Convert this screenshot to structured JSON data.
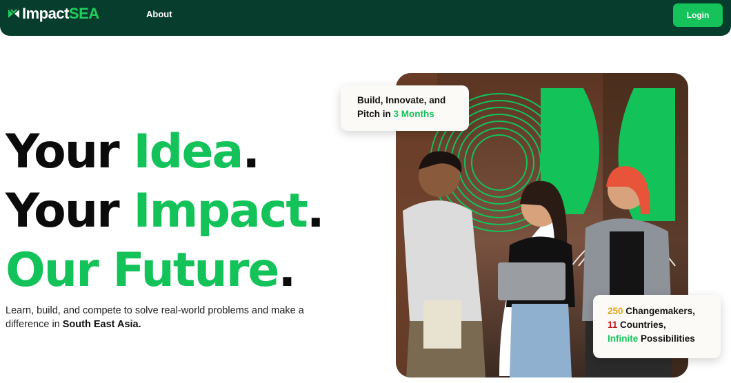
{
  "nav": {
    "logo_prefix": "Impact",
    "logo_suffix": "SEA",
    "about_label": "About",
    "login_label": "Login"
  },
  "hero": {
    "line1_a": "Your ",
    "line1_b": "Idea",
    "line2_a": "Your ",
    "line2_b": "Impact",
    "line3": "Our Future",
    "period": ".",
    "subtitle_text": "Learn, build, and compete to solve real-world problems and make a difference in ",
    "subtitle_bold": "South East Asia."
  },
  "callout_top": {
    "line1": "Build, Innovate, and",
    "line2_prefix": "Pitch in ",
    "line2_highlight": "3 Months"
  },
  "callout_bottom": {
    "stat1_num": "250",
    "stat1_label": " Changemakers,",
    "stat2_num": "11",
    "stat2_label": " Countries,",
    "stat3_num": "Infinite",
    "stat3_label": " Possibilities"
  },
  "colors": {
    "nav_bg": "#073d2c",
    "accent_green": "#14c25a",
    "gold": "#e2a61a",
    "red": "#c0141c"
  },
  "icons": {
    "logo": "impactsea-logo-icon"
  }
}
